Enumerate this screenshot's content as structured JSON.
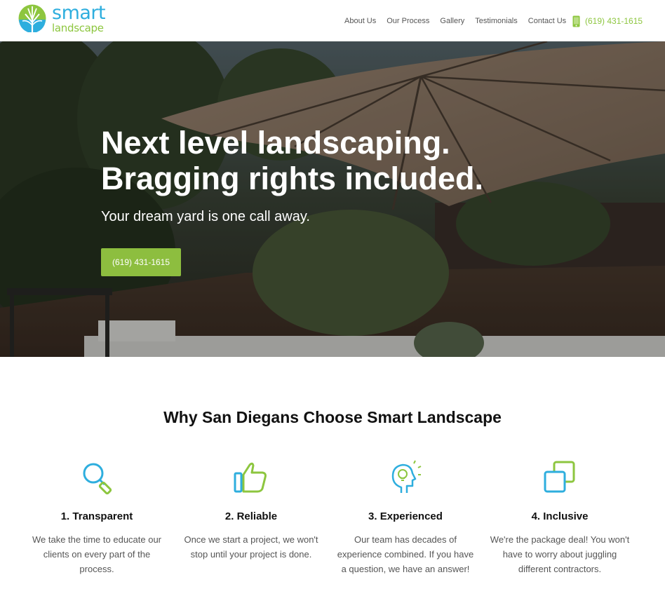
{
  "brand": {
    "name_line1": "smart",
    "name_line2": "landscape",
    "blue": "#2eaede",
    "green": "#8dc63f"
  },
  "nav": {
    "items": [
      "About Us",
      "Our Process",
      "Gallery",
      "Testimonials",
      "Contact Us"
    ],
    "phone": "(619) 431-1615",
    "phone_icon": "mobile-phone-icon"
  },
  "hero": {
    "title_line1": "Next level landscaping.",
    "title_line2": "Bragging rights included.",
    "subtitle": "Your dream yard is one call away.",
    "cta": "(619) 431-1615",
    "cta_color": "#8dbe3f"
  },
  "why": {
    "title": "Why San Diegans Choose Smart Landscape",
    "features": [
      {
        "icon": "magnifier-icon",
        "title": "1. Transparent",
        "text": "We take the time to educate our clients on every part of the process."
      },
      {
        "icon": "thumbs-up-icon",
        "title": "2. Reliable",
        "text": "Once we start a project, we won't stop until your project is done."
      },
      {
        "icon": "head-lightbulb-icon",
        "title": "3. Experienced",
        "text": "Our team has decades of experience combined. If you have a question, we have an answer!"
      },
      {
        "icon": "overlapping-squares-icon",
        "title": "4. Inclusive",
        "text": "We're the package deal! You won't have to worry about juggling different contractors."
      }
    ]
  }
}
